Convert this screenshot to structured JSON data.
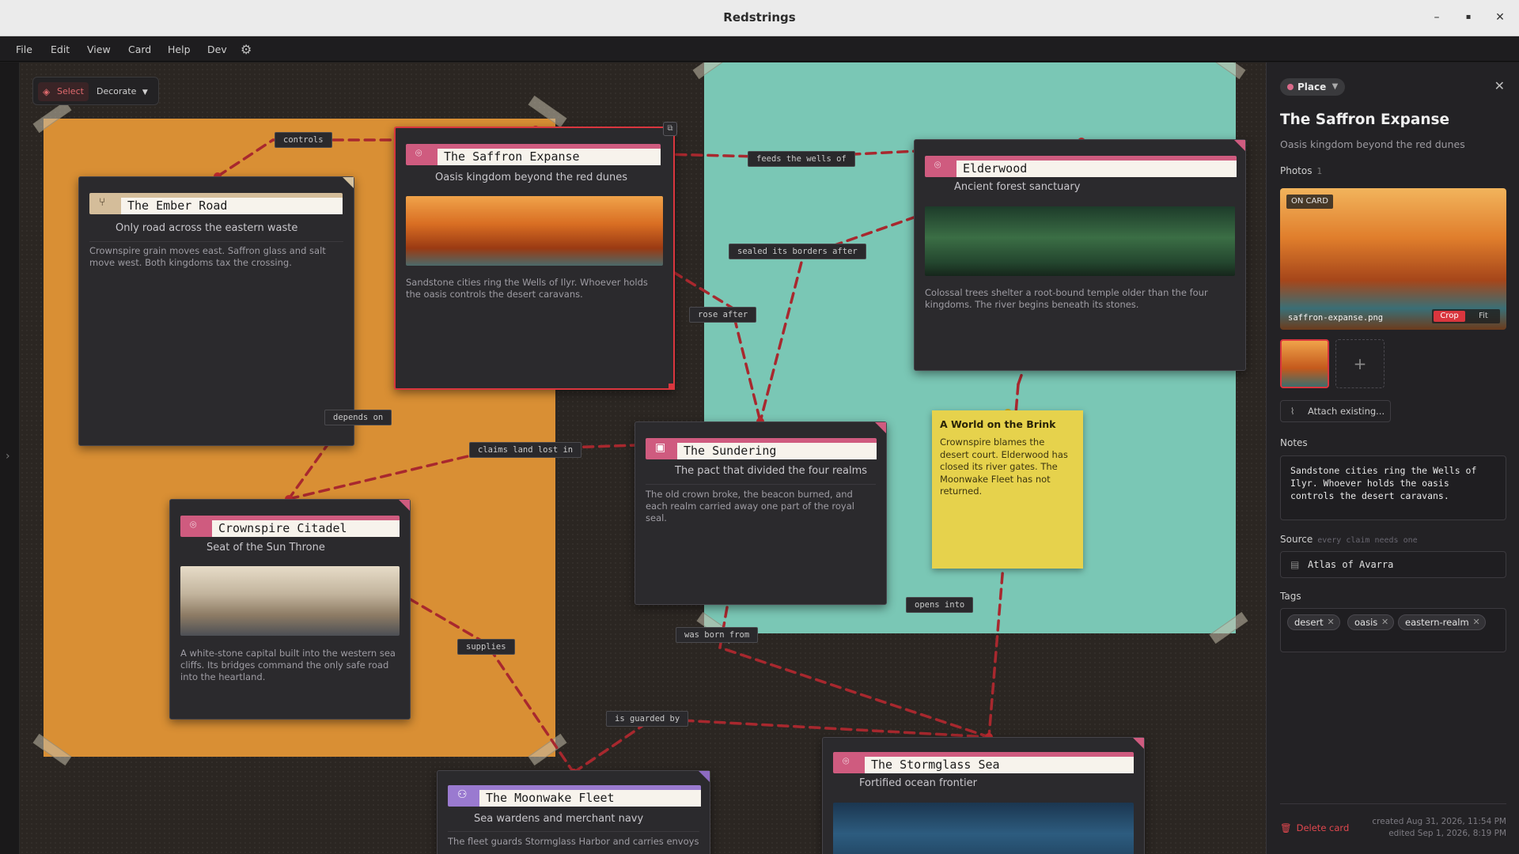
{
  "window": {
    "title": "Redstrings"
  },
  "menu": {
    "items": [
      "File",
      "Edit",
      "View",
      "Card",
      "Help",
      "Dev"
    ]
  },
  "toolbar": {
    "select_label": "Select",
    "decorate_label": "Decorate"
  },
  "cards": {
    "ember": {
      "name": "The Ember Road",
      "subtitle": "Only road across the eastern waste",
      "body": "Crownspire grain moves east. Saffron glass and salt move west. Both kingdoms tax the crossing."
    },
    "saffron": {
      "name": "The Saffron Expanse",
      "subtitle": "Oasis kingdom beyond the red dunes",
      "body": "Sandstone cities ring the Wells of Ilyr. Whoever holds the oasis controls the desert caravans."
    },
    "elder": {
      "name": "Elderwood",
      "subtitle": "Ancient forest sanctuary",
      "body": "Colossal trees shelter a root-bound temple older than the four kingdoms. The river begins beneath its stones."
    },
    "sundering": {
      "name": "The Sundering",
      "subtitle": "The pact that divided the four realms",
      "body": "The old crown broke, the beacon burned, and each realm carried away one part of the royal seal."
    },
    "crown": {
      "name": "Crownspire Citadel",
      "subtitle": "Seat of the Sun Throne",
      "body": "A white-stone capital built into the western sea cliffs. Its bridges command the only safe road into the heartland."
    },
    "moon": {
      "name": "The Moonwake Fleet",
      "subtitle": "Sea wardens and merchant navy",
      "body": "The fleet guards Stormglass Harbor and carries envoys"
    },
    "storm": {
      "name": "The Stormglass Sea",
      "subtitle": "Fortified ocean frontier"
    }
  },
  "sticky": {
    "title": "A World on the Brink",
    "body": "Crownspire blames the desert court. Elderwood has closed its river gates. The Moonwake Fleet has not returned."
  },
  "connections": {
    "controls": "controls",
    "feeds": "feeds the wells of",
    "sealed": "sealed its borders after",
    "rose": "rose after",
    "depends": "depends on",
    "claims": "claims land lost in",
    "supplies": "supplies",
    "opens": "opens into",
    "born": "was born from",
    "guarded": "is guarded by"
  },
  "panel": {
    "type": "Place",
    "title": "The Saffron Expanse",
    "subtitle": "Oasis kingdom beyond the red dunes",
    "photos_label": "Photos",
    "photos_count": "1",
    "on_card": "ON CARD",
    "photo_name": "saffron-expanse.png",
    "crop": "Crop",
    "fit": "Fit",
    "attach": "Attach existing...",
    "notes_label": "Notes",
    "notes": "Sandstone cities ring the Wells of Ilyr. Whoever holds the oasis controls the desert caravans.",
    "source_label": "Source",
    "source_hint": "every claim needs one",
    "source": "Atlas of Avarra",
    "tags_label": "Tags",
    "tags": [
      "desert",
      "oasis",
      "eastern-realm"
    ],
    "delete": "Delete card",
    "created": "created Aug 31, 2026, 11:54 PM",
    "edited": "edited Sep 1, 2026, 8:19 PM"
  },
  "colors": {
    "accent": "#d9363e",
    "place_pink": "#cf5b7f",
    "region_orange": "#d98f34",
    "region_teal": "#7ac7b5",
    "sticky_yellow": "#e6d24c"
  }
}
